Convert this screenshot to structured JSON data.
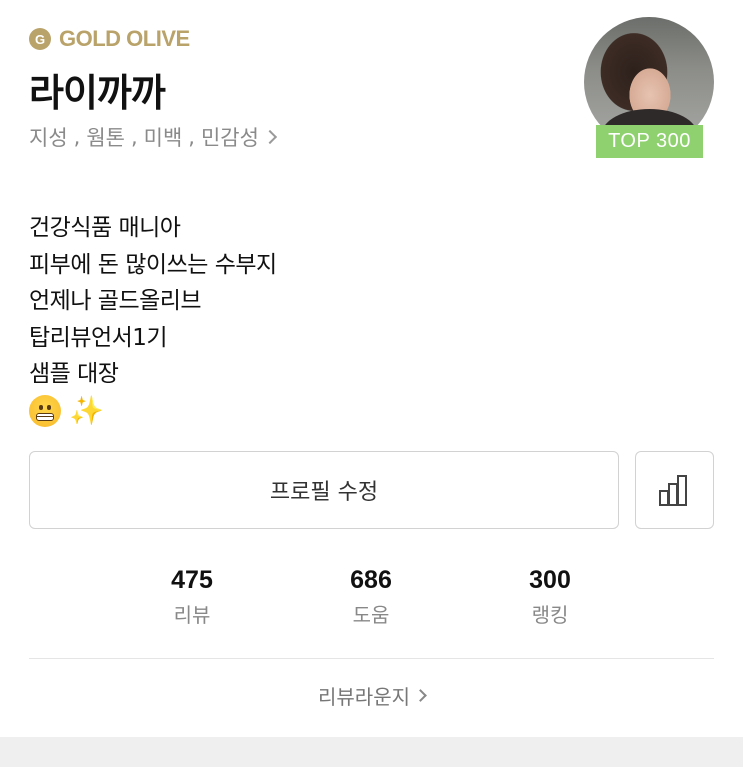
{
  "grade": {
    "badge_letter": "G",
    "label": "GOLD OLIVE",
    "color": "#b9a36a"
  },
  "profile": {
    "nickname": "라이까까",
    "skin_types": [
      "지성",
      "웜톤",
      "미백",
      "민감성"
    ],
    "avatar_label": "profile-photo",
    "rank_badge": "TOP 300",
    "rank_badge_color": "#8fd16f"
  },
  "bio": {
    "lines": [
      "건강식품 매니아",
      "피부에 돈 많이쓰는 수부지",
      "언제나 골드올리브",
      "탑리뷰언서1기",
      "샘플 대장"
    ],
    "emojis": [
      "grimacing-face-icon",
      "sparkles-icon"
    ]
  },
  "actions": {
    "edit_profile": "프로필 수정",
    "stats_icon": "bar-chart-icon"
  },
  "stats": [
    {
      "value": "475",
      "label": "리뷰"
    },
    {
      "value": "686",
      "label": "도움"
    },
    {
      "value": "300",
      "label": "랭킹"
    }
  ],
  "lounge": {
    "label": "리뷰라운지"
  }
}
